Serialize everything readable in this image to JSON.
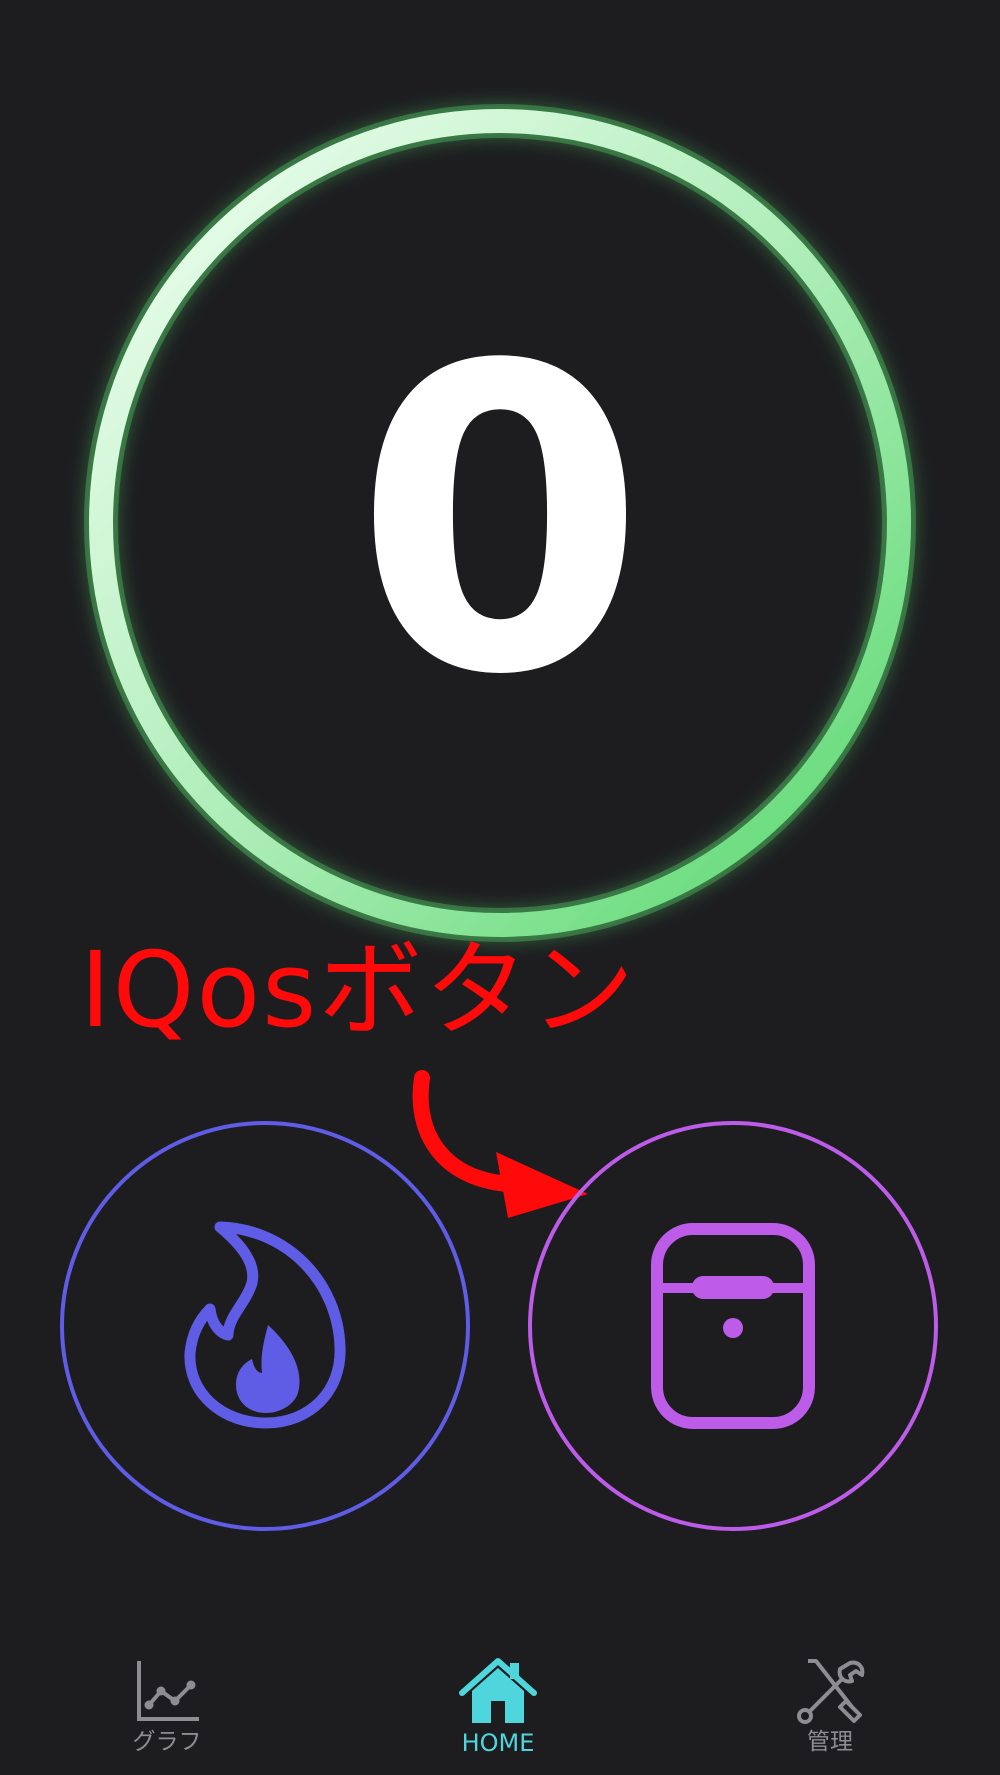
{
  "counter": {
    "value": "0",
    "ring_gradient_start": "#f2fff3",
    "ring_gradient_end": "#5ddc74"
  },
  "annotation": {
    "label": "IQosボタン",
    "color": "#ff0a0a"
  },
  "actions": {
    "smoke_button": {
      "icon": "flame-icon",
      "color": "#5f5ce6"
    },
    "iqos_button": {
      "icon": "iqos-device-icon",
      "color": "#bc5ce8"
    }
  },
  "bottom_nav": {
    "items": [
      {
        "label": "グラフ",
        "icon": "line-chart-icon",
        "active": false
      },
      {
        "label": "HOME",
        "icon": "home-icon",
        "active": true
      },
      {
        "label": "管理",
        "icon": "tools-icon",
        "active": false
      }
    ],
    "active_color": "#4fd6dc",
    "inactive_color": "#8d8d92"
  }
}
